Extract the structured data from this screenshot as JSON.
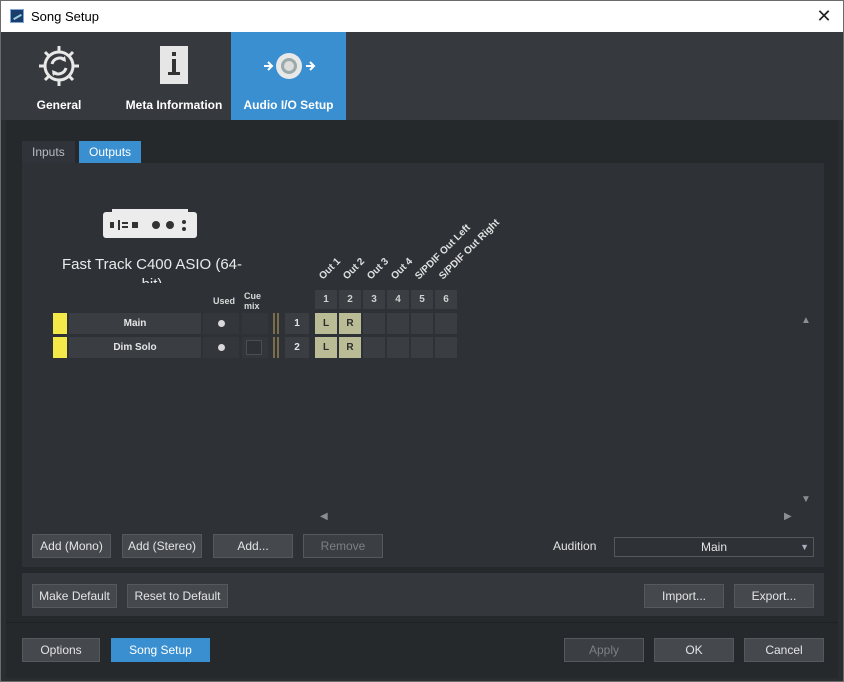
{
  "window": {
    "title": "Song Setup",
    "close_glyph": "✕"
  },
  "top_tabs": [
    {
      "label": "General",
      "icon": "gear-icon",
      "active": false
    },
    {
      "label": "Meta Information",
      "icon": "info-icon",
      "active": false
    },
    {
      "label": "Audio I/O Setup",
      "icon": "audio-io-icon",
      "active": true
    }
  ],
  "sub_tabs": [
    {
      "label": "Inputs",
      "active": false
    },
    {
      "label": "Outputs",
      "active": true
    }
  ],
  "device": {
    "name": "Fast Track C400 ASIO (64-bit)",
    "icon": "audio-interface-icon"
  },
  "matrix": {
    "col_used": "Used",
    "col_cue": "Cue mix",
    "outputs": [
      {
        "num": "1",
        "label": "Out 1"
      },
      {
        "num": "2",
        "label": "Out 2"
      },
      {
        "num": "3",
        "label": "Out 3"
      },
      {
        "num": "4",
        "label": "Out 4"
      },
      {
        "num": "5",
        "label": "S/PDIF Out Left"
      },
      {
        "num": "6",
        "label": "S/PDIF Out Right"
      }
    ],
    "rows": [
      {
        "name": "Main",
        "num": "1",
        "used": true,
        "cue": false,
        "cells": [
          "L",
          "R",
          "",
          "",
          "",
          ""
        ],
        "color": "#f5e94a"
      },
      {
        "name": "Dim Solo",
        "num": "2",
        "used": true,
        "cue": true,
        "cells": [
          "L",
          "R",
          "",
          "",
          "",
          ""
        ],
        "color": "#f5e94a"
      }
    ]
  },
  "buttons": {
    "add_mono": "Add (Mono)",
    "add_stereo": "Add (Stereo)",
    "add": "Add...",
    "remove": "Remove",
    "make_default": "Make Default",
    "reset_default": "Reset to Default",
    "import": "Import...",
    "export": "Export...",
    "options": "Options",
    "song_setup": "Song Setup",
    "apply": "Apply",
    "ok": "OK",
    "cancel": "Cancel"
  },
  "audition": {
    "label": "Audition",
    "value": "Main"
  },
  "arrows": {
    "up": "▲",
    "down": "▼",
    "left": "◀",
    "right": "▶",
    "caret": "▼"
  },
  "colors": {
    "accent": "#3a8fd1",
    "row_swatch": "#f5e94a",
    "active_cell": "#b9bc94"
  }
}
